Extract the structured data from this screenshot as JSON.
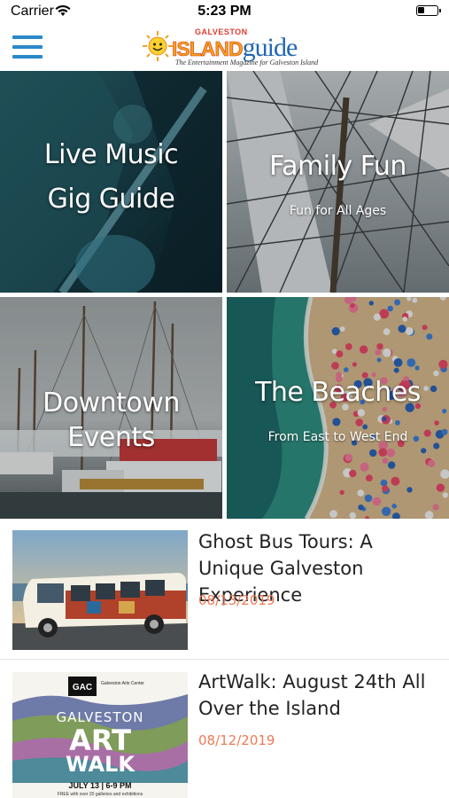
{
  "status_bar": {
    "carrier": "Carrier",
    "time": "5:23 PM",
    "battery_level": 0.35
  },
  "header": {
    "logo_top": "GALVESTON",
    "logo_island": "ISLAND",
    "logo_guide": "guide",
    "logo_tagline": "The Entertainment Magazine for Galveston Island"
  },
  "tiles": [
    {
      "title_line1": "Live Music",
      "title_line2": "Gig Guide",
      "subtitle": ""
    },
    {
      "title": "Family Fun",
      "subtitle": "Fun for All Ages"
    },
    {
      "title": "Downtown Events",
      "subtitle": ""
    },
    {
      "title": "The Beaches",
      "subtitle": "From East to West End"
    }
  ],
  "articles": [
    {
      "title": "Ghost Bus Tours: A Unique Galveston Experience",
      "date": "08/13/2019"
    },
    {
      "title": "ArtWalk: August 24th All Over the Island",
      "date": "08/12/2019",
      "poster": {
        "badge": "GAC",
        "org": "Galveston Arts Center",
        "city": "GALVESTON",
        "art": "ART",
        "walk": "WALK",
        "event_date": "JULY 13 | 6-9 PM",
        "note": "FREE with over 20 galleries and exhibitions"
      }
    }
  ],
  "colors": {
    "accent": "#2b88c9",
    "date": "#ee7a57",
    "logo_orange": "#f4a11d",
    "logo_blue": "#2167b3"
  }
}
